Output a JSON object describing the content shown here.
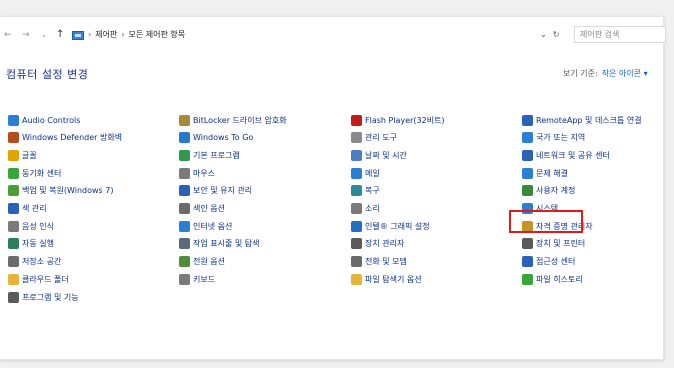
{
  "addressbar": {
    "back": "←",
    "forward": "→",
    "dropdown": "⌄",
    "up": "↑",
    "crumb1": "제어판",
    "crumb2": "모든 제어판 항목",
    "dd2": "⌄",
    "refresh": "↻",
    "search_placeholder": "제어판 검색"
  },
  "page": {
    "title": "컴퓨터 설정 변경",
    "viewby_label": "보기 기준:",
    "viewby_value": "작은 아이콘 ▾"
  },
  "columns": [
    [
      {
        "label": "Audio Controls",
        "icon": "audio-icon",
        "color": "#2a7fd4"
      },
      {
        "label": "Windows Defender 방화벽",
        "icon": "firewall-icon",
        "color": "#b34d1e"
      },
      {
        "label": "글꼴",
        "icon": "font-icon",
        "color": "#e2a400"
      },
      {
        "label": "동기화 센터",
        "icon": "sync-icon",
        "color": "#3aa63a"
      },
      {
        "label": "백업 및 복원(Windows 7)",
        "icon": "backup-icon",
        "color": "#4f9d3a"
      },
      {
        "label": "색 관리",
        "icon": "color-management-icon",
        "color": "#2a62b8"
      },
      {
        "label": "음성 인식",
        "icon": "microphone-icon",
        "color": "#7a7a7a"
      },
      {
        "label": "자동 실행",
        "icon": "autoplay-icon",
        "color": "#2f7d5c"
      },
      {
        "label": "저장소 공간",
        "icon": "storage-icon",
        "color": "#6c6c6c"
      },
      {
        "label": "클라우드 폴더",
        "icon": "cloud-folder-icon",
        "color": "#e6b43a"
      },
      {
        "label": "프로그램 및 기능",
        "icon": "programs-icon",
        "color": "#5a5a5a"
      }
    ],
    [
      {
        "label": "BitLocker 드라이브 암호화",
        "icon": "bitlocker-icon",
        "color": "#a88a3c"
      },
      {
        "label": "Windows To Go",
        "icon": "windows-to-go-icon",
        "color": "#2a78d0"
      },
      {
        "label": "기본 프로그램",
        "icon": "default-programs-icon",
        "color": "#2e9a4a"
      },
      {
        "label": "마우스",
        "icon": "mouse-icon",
        "color": "#7a7a7a"
      },
      {
        "label": "보안 및 유지 관리",
        "icon": "flag-icon",
        "color": "#2a62b8"
      },
      {
        "label": "색인 옵션",
        "icon": "indexing-icon",
        "color": "#6a6a6a"
      },
      {
        "label": "인터넷 옵션",
        "icon": "internet-icon",
        "color": "#2a7fd4"
      },
      {
        "label": "작업 표시줄 및 탐색",
        "icon": "taskbar-icon",
        "color": "#5a6a7a"
      },
      {
        "label": "전원 옵션",
        "icon": "power-icon",
        "color": "#4f8d3a"
      },
      {
        "label": "키보드",
        "icon": "keyboard-icon",
        "color": "#7a7a7a"
      }
    ],
    [
      {
        "label": "Flash Player(32비트)",
        "icon": "flash-icon",
        "color": "#c21d1d"
      },
      {
        "label": "관리 도구",
        "icon": "admin-tools-icon",
        "color": "#8a8a8a"
      },
      {
        "label": "날짜 및 시간",
        "icon": "clock-icon",
        "color": "#4a7fbf"
      },
      {
        "label": "메일",
        "icon": "mail-icon",
        "color": "#2a7fd4"
      },
      {
        "label": "복구",
        "icon": "recovery-icon",
        "color": "#2e8a9a"
      },
      {
        "label": "소리",
        "icon": "sound-icon",
        "color": "#7a7a7a"
      },
      {
        "label": "인텔® 그래픽 설정",
        "icon": "intel-graphics-icon",
        "color": "#1f6fc2"
      },
      {
        "label": "장치 관리자",
        "icon": "device-manager-icon",
        "color": "#5a5a5a"
      },
      {
        "label": "전화 및 모뎀",
        "icon": "phone-icon",
        "color": "#6a6a6a"
      },
      {
        "label": "파일 탐색기 옵션",
        "icon": "folder-options-icon",
        "color": "#e6b43a"
      }
    ],
    [
      {
        "label": "RemoteApp 및 데스크톱 연결",
        "icon": "remoteapp-icon",
        "color": "#2a62b8"
      },
      {
        "label": "국가 또는 지역",
        "icon": "region-icon",
        "color": "#2a7fd4"
      },
      {
        "label": "네트워크 및 공유 센터",
        "icon": "network-icon",
        "color": "#2a62b8"
      },
      {
        "label": "문제 해결",
        "icon": "troubleshoot-icon",
        "color": "#2a7fd4"
      },
      {
        "label": "사용자 계정",
        "icon": "user-accounts-icon",
        "color": "#3a8a3a"
      },
      {
        "label": "시스템",
        "icon": "system-icon",
        "color": "#2a7fd4"
      },
      {
        "label": "자격 증명 관리자",
        "icon": "credential-icon",
        "color": "#c8922a"
      },
      {
        "label": "장치 및 프린터",
        "icon": "printer-icon",
        "color": "#5a5a5a"
      },
      {
        "label": "접근성 센터",
        "icon": "accessibility-icon",
        "color": "#2a62b8"
      },
      {
        "label": "파일 히스토리",
        "icon": "file-history-icon",
        "color": "#3aa63a"
      }
    ]
  ]
}
